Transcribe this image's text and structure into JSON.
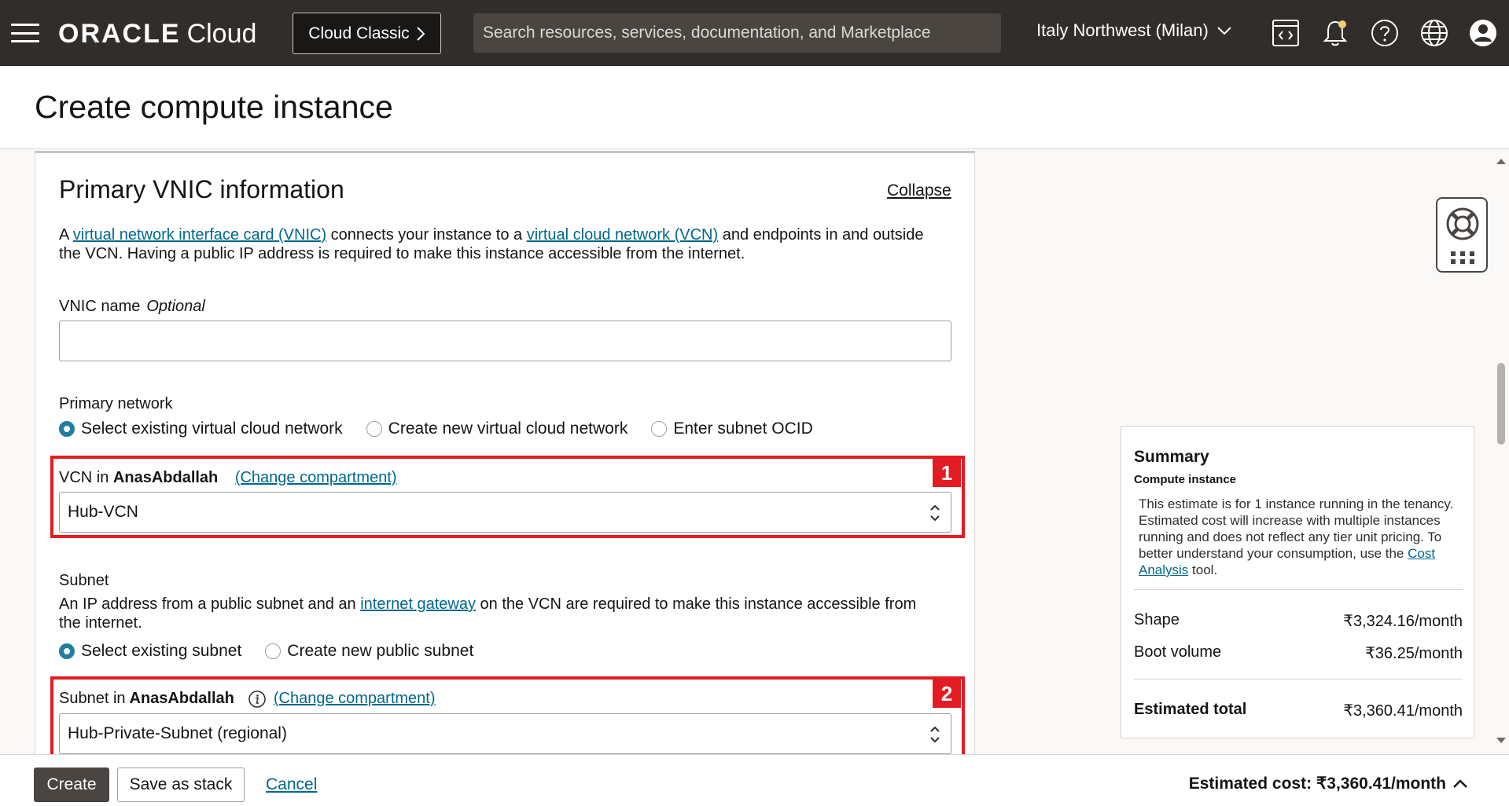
{
  "header": {
    "logo_brand": "ORACLE",
    "logo_product": "Cloud",
    "classic_button": "Cloud Classic",
    "search_placeholder": "Search resources, services, documentation, and Marketplace",
    "region": "Italy Northwest (Milan)",
    "icons": [
      "menu-icon",
      "code-editor-icon",
      "bell-icon",
      "help-icon",
      "globe-icon",
      "user-icon"
    ]
  },
  "page": {
    "title": "Create compute instance"
  },
  "section": {
    "title": "Primary VNIC information",
    "collapse": "Collapse",
    "desc_prefix": "A ",
    "desc_link1": "virtual network interface card (VNIC)",
    "desc_mid": " connects your instance to a ",
    "desc_link2": "virtual cloud network (VCN)",
    "desc_suffix": " and endpoints in and outside the VCN. Having a public IP address is required to make this instance accessible from the internet.",
    "vnic_name_label": "VNIC name",
    "vnic_name_optional": "Optional",
    "vnic_name_value": "",
    "primary_network_label": "Primary network",
    "network_options": [
      "Select existing virtual cloud network",
      "Create new virtual cloud network",
      "Enter subnet OCID"
    ],
    "network_selected": 0,
    "vcn_label_prefix": "VCN in ",
    "vcn_compartment": "AnasAbdallah",
    "change_compartment": "(Change compartment)",
    "vcn_value": "Hub-VCN",
    "subnet_label": "Subnet",
    "subnet_desc_prefix": "An IP address from a public subnet and an ",
    "subnet_desc_link": "internet gateway",
    "subnet_desc_suffix": " on the VCN are required to make this instance accessible from the internet.",
    "subnet_options": [
      "Select existing subnet",
      "Create new public subnet"
    ],
    "subnet_selected": 0,
    "subnet_in_prefix": "Subnet in ",
    "subnet_compartment": "AnasAbdallah",
    "subnet_value": "Hub-Private-Subnet (regional)",
    "badge1": "1",
    "badge2": "2"
  },
  "summary": {
    "title": "Summary",
    "subtitle": "Compute instance",
    "note_prefix": "This estimate is for 1 instance running in the tenancy. Estimated cost will increase with multiple instances running and does not reflect any tier unit pricing. To better understand your consumption, use the ",
    "note_link": "Cost Analysis",
    "note_suffix": " tool.",
    "rows": [
      {
        "label": "Shape",
        "value": "₹3,324.16/month"
      },
      {
        "label": "Boot volume",
        "value": "₹36.25/month"
      }
    ],
    "total_label": "Estimated total",
    "total_value": "₹3,360.41/month"
  },
  "footer": {
    "create": "Create",
    "save_stack": "Save as stack",
    "cancel": "Cancel",
    "estimated_cost": "Estimated cost: ₹3,360.41/month"
  },
  "colors": {
    "header_bg": "#312d2a",
    "accent": "#227e9e",
    "link": "#00688c",
    "highlight": "#e31b23"
  }
}
